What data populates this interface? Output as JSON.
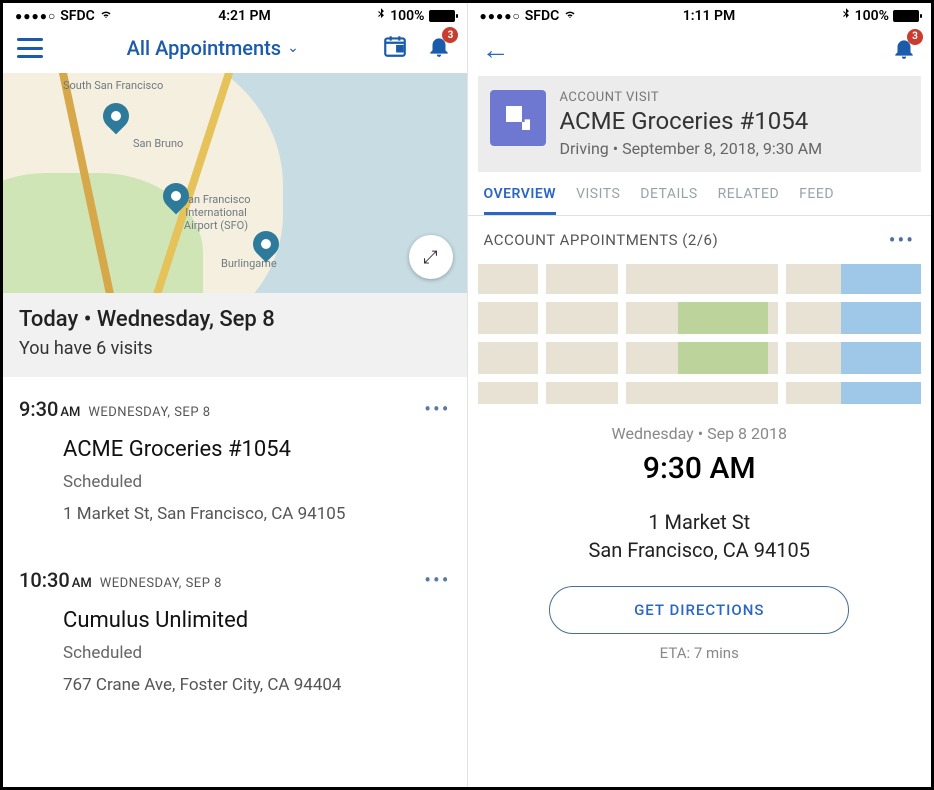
{
  "left": {
    "status": {
      "carrier": "SFDC",
      "time": "4:21 PM",
      "battery": "100%"
    },
    "header": {
      "title": "All Appointments",
      "notifications": "3"
    },
    "map": {
      "labels": [
        "South San Francisco",
        "San Bruno",
        "San Francisco International Airport (SFO)",
        "Burlingame"
      ]
    },
    "today": {
      "line1": "Today • Wednesday, Sep 8",
      "line2": "You have 6 visits"
    },
    "visits": [
      {
        "time": "9:30",
        "ampm": "AM",
        "date": "WEDNESDAY, SEP 8",
        "title": "ACME Groceries #1054",
        "status": "Scheduled",
        "addr": "1 Market St, San Francisco, CA 94105"
      },
      {
        "time": "10:30",
        "ampm": "AM",
        "date": "WEDNESDAY, SEP 8",
        "title": "Cumulus Unlimited",
        "status": "Scheduled",
        "addr": "767 Crane Ave, Foster City, CA 94404"
      }
    ]
  },
  "right": {
    "status": {
      "carrier": "SFDC",
      "time": "1:11 PM",
      "battery": "100%"
    },
    "header": {
      "notifications": "3"
    },
    "card": {
      "label": "ACCOUNT VISIT",
      "title": "ACME Groceries #1054",
      "sub": "Driving • September 8, 2018, 9:30 AM"
    },
    "tabs": [
      "OVERVIEW",
      "VISITS",
      "DETAILS",
      "RELATED",
      "FEED"
    ],
    "section": "ACCOUNT APPOINTMENTS (2/6)",
    "detail": {
      "date": "Wednesday • Sep 8 2018",
      "time": "9:30 AM",
      "addr1": "1 Market St",
      "addr2": "San Francisco, CA 94105",
      "button": "GET DIRECTIONS",
      "eta": "ETA: 7 mins"
    }
  }
}
